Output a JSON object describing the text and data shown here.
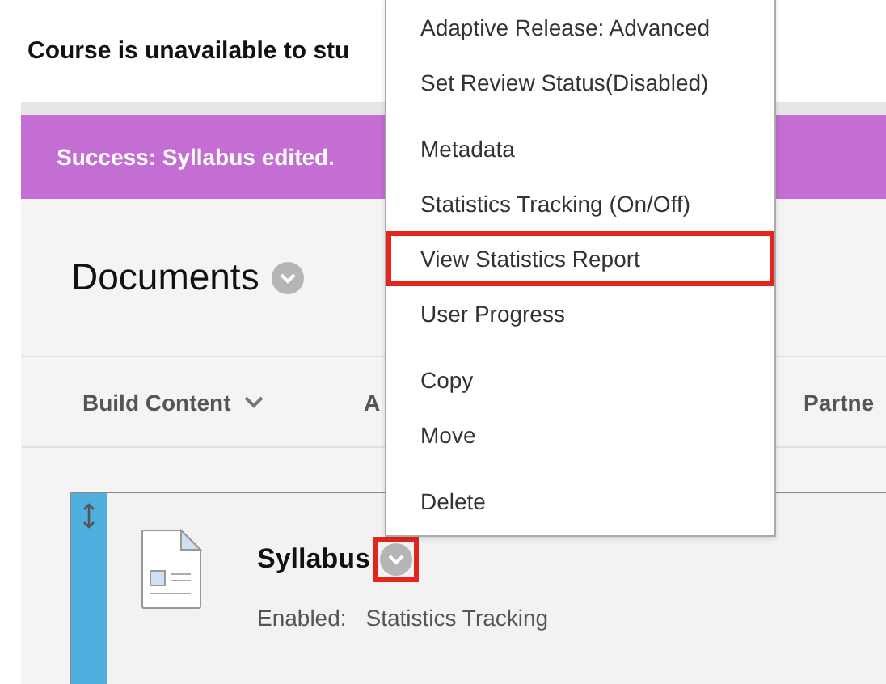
{
  "notice": "Course is unavailable to stu",
  "banner": "Success: Syllabus edited.",
  "heading": "Documents",
  "toolbar": [
    {
      "label": "Build Content",
      "dropdown": true
    },
    {
      "label": "A"
    },
    {
      "label": "Partne"
    }
  ],
  "item": {
    "title": "Syllabus",
    "meta_label": "Enabled:",
    "meta_value": "Statistics Tracking",
    "menu_highlighted": true
  },
  "menu": {
    "groups": [
      [
        {
          "label": "Adaptive Release: Advanced",
          "highlighted": false
        },
        {
          "label": "Set Review Status(Disabled)",
          "highlighted": false
        }
      ],
      [
        {
          "label": "Metadata",
          "highlighted": false
        },
        {
          "label": "Statistics Tracking (On/Off)",
          "highlighted": false
        },
        {
          "label": "View Statistics Report",
          "highlighted": true
        },
        {
          "label": "User Progress",
          "highlighted": false
        }
      ],
      [
        {
          "label": "Copy",
          "highlighted": false
        },
        {
          "label": "Move",
          "highlighted": false
        }
      ],
      [
        {
          "label": "Delete",
          "highlighted": false
        }
      ]
    ]
  }
}
